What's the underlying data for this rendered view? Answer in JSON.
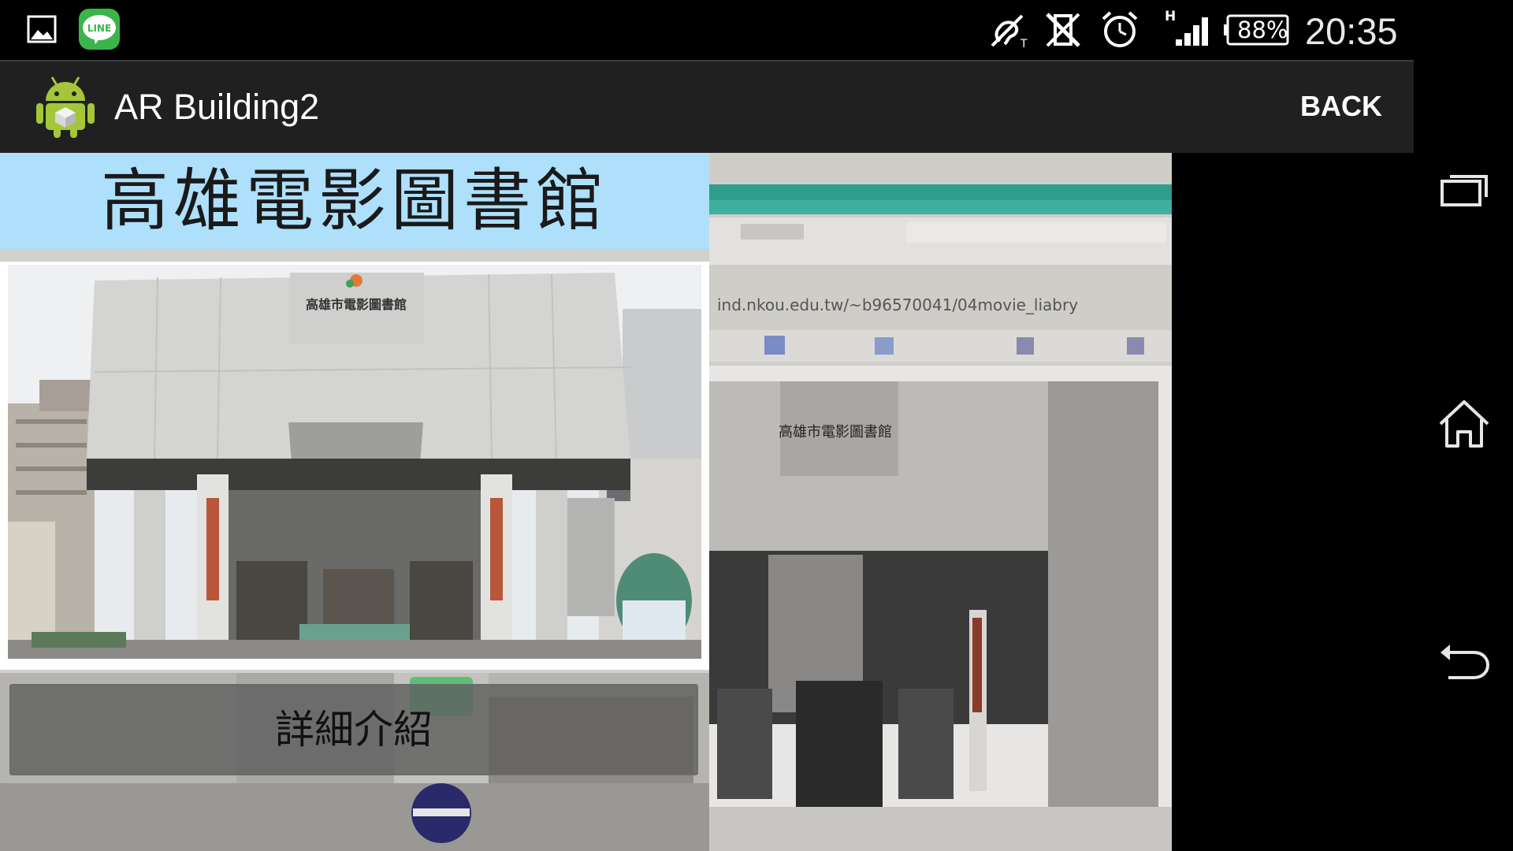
{
  "status_bar": {
    "battery_percent": "88%",
    "time": "20:35",
    "network_type": "H",
    "icons": [
      "gallery-icon",
      "line-app-icon",
      "hearing-aid-icon",
      "vibrate-off-icon",
      "alarm-icon",
      "signal-icon",
      "battery-icon"
    ],
    "line_badge": "LINE"
  },
  "action_bar": {
    "app_title": "AR Building2",
    "back_label": "BACK",
    "app_icon": "android-app-icon"
  },
  "overlay": {
    "building_name": "高雄電影圖書館",
    "building_sign": "高雄市電影圖書館",
    "detail_button": "詳細介紹"
  },
  "camera_view": {
    "browser_url": "ind.nkou.edu.tw/~b96570041/04movie_liabry",
    "sign_text": "高雄市電影圖書館"
  },
  "navigation_bar": {
    "icons": [
      "recent-apps-icon",
      "home-icon",
      "back-icon"
    ]
  },
  "colors": {
    "title_panel": "#aee0fc",
    "action_bar": "#202020",
    "line_green": "#3ab54a",
    "android_green": "#a4c639"
  }
}
